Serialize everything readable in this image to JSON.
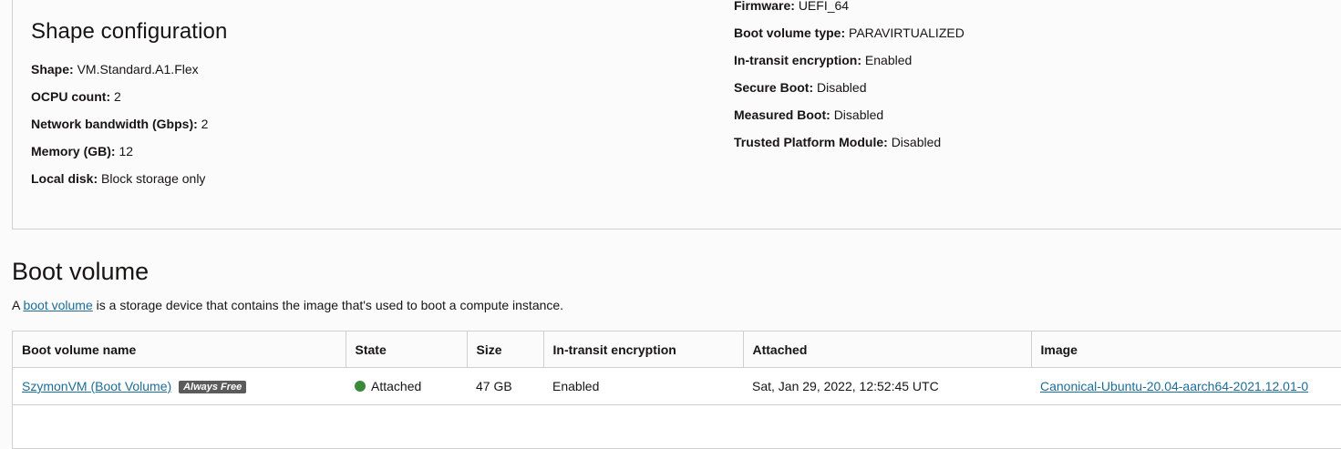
{
  "shape_config": {
    "title": "Shape configuration",
    "left_fields": [
      {
        "key": "Shape:",
        "value": "VM.Standard.A1.Flex"
      },
      {
        "key": "OCPU count:",
        "value": "2"
      },
      {
        "key": "Network bandwidth (Gbps):",
        "value": "2"
      },
      {
        "key": "Memory (GB):",
        "value": "12"
      },
      {
        "key": "Local disk:",
        "value": "Block storage only"
      }
    ],
    "right_fields": [
      {
        "key": "Firmware:",
        "value": "UEFI_64"
      },
      {
        "key": "Boot volume type:",
        "value": "PARAVIRTUALIZED"
      },
      {
        "key": "In-transit encryption:",
        "value": "Enabled"
      },
      {
        "key": "Secure Boot:",
        "value": "Disabled"
      },
      {
        "key": "Measured Boot:",
        "value": "Disabled"
      },
      {
        "key": "Trusted Platform Module:",
        "value": "Disabled"
      }
    ]
  },
  "boot_volume": {
    "title": "Boot volume",
    "desc_prefix": "A",
    "desc_link": "boot volume",
    "desc_suffix": "is a storage device that contains the image that's used to boot a compute instance.",
    "columns": [
      "Boot volume name",
      "State",
      "Size",
      "In-transit encryption",
      "Attached",
      "Image"
    ],
    "rows": [
      {
        "name": "SzymonVM (Boot Volume)",
        "badge": "Always Free",
        "state": "Attached",
        "state_color": "#3a8a3a",
        "size": "47 GB",
        "encryption": "Enabled",
        "attached": "Sat, Jan 29, 2022, 12:52:45 UTC",
        "image": "Canonical-Ubuntu-20.04-aarch64-2021.12.01-0"
      }
    ]
  },
  "colors": {
    "link": "#1c6d99",
    "border": "#cfcfcf",
    "badge_bg": "#5b5b5b"
  }
}
